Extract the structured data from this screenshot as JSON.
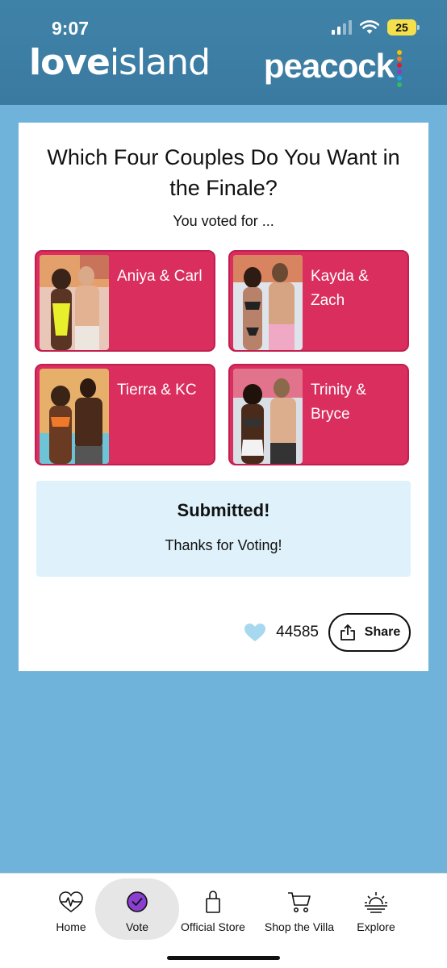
{
  "status_bar": {
    "time": "9:07",
    "battery": "25"
  },
  "header": {
    "brand_left_bold": "love",
    "brand_left_rest": "island",
    "brand_right": "peacock",
    "peacock_dot_colors": [
      "#f5c400",
      "#f27b20",
      "#e5153b",
      "#8b3dbf",
      "#1ea3e0",
      "#2fbf58"
    ]
  },
  "poll": {
    "question": "Which Four Couples Do You Want in the Finale?",
    "voted_for_label": "You voted for ...",
    "couples": [
      {
        "name": "Aniya & Carl"
      },
      {
        "name": "Kayda & Zach"
      },
      {
        "name": "Tierra & KC"
      },
      {
        "name": "Trinity & Bryce"
      }
    ],
    "submitted_title": "Submitted!",
    "submitted_subtitle": "Thanks for Voting!",
    "like_count": "44585",
    "share_label": "Share"
  },
  "colors": {
    "couple_card": "#d92e5e",
    "header_bg": "#3f82a8",
    "page_bg": "#6fb3db",
    "submitted_bg": "#dff2fb",
    "vote_icon": "#8a3fd1"
  },
  "bottom_nav": {
    "items": [
      {
        "label": "Home",
        "icon": "heartbeat-icon"
      },
      {
        "label": "Vote",
        "icon": "vote-check-icon"
      },
      {
        "label": "Official Store",
        "icon": "shopping-bag-icon"
      },
      {
        "label": "Shop the Villa",
        "icon": "cart-icon"
      },
      {
        "label": "Explore",
        "icon": "sunset-icon"
      }
    ],
    "active": "Vote"
  }
}
